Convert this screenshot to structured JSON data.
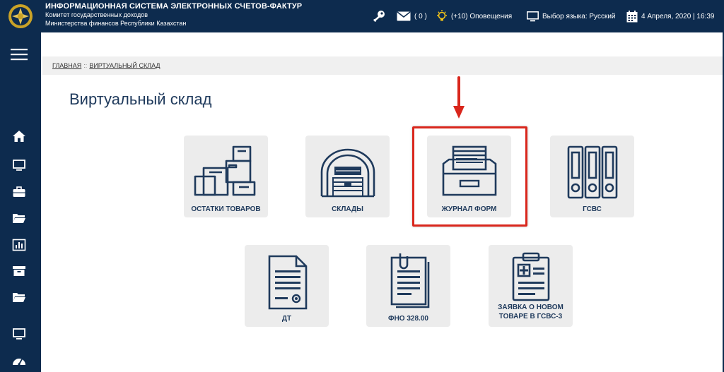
{
  "header": {
    "title_line1": "ИНФОРМАЦИОННАЯ СИСТЕМА ЭЛЕКТРОННЫХ СЧЕТОВ-ФАКТУР",
    "title_line2": "Комитет государственных доходов",
    "title_line3": "Министерства финансов Республики Казахстан",
    "messages_count": "( 0 )",
    "notifications": "(+10) Оповещения",
    "language": "Выбор языка: Русский",
    "datetime": "4 Апреля, 2020 | 16:39"
  },
  "breadcrumb": {
    "home": "ГЛАВНАЯ",
    "separator": "::",
    "current": "ВИРТУАЛЬНЫЙ СКЛАД"
  },
  "page": {
    "title": "Виртуальный склад"
  },
  "tiles": {
    "stock": "ОСТАТКИ ТОВАРОВ",
    "warehouses": "СКЛАДЫ",
    "journal": "ЖУРНАЛ ФОРМ",
    "gsvs": "ГСВС",
    "dt": "ДТ",
    "fno": "ФНО 328.00",
    "request_line1": "ЗАЯВКА О НОВОМ",
    "request_line2": "ТОВАРЕ В ГСВС-3"
  },
  "colors": {
    "navy": "#0d2b4e",
    "icon_blue": "#1f3a5c",
    "highlight_red": "#d9261c",
    "tile_bg": "#ececec"
  },
  "icons": [
    "menu-icon",
    "home-icon",
    "monitor-icon",
    "briefcase-icon",
    "folder-icon",
    "chart-icon",
    "archive-icon",
    "folder-icon",
    "desktop-icon",
    "dashboard-icon",
    "key-icon",
    "mail-icon",
    "bulb-icon",
    "calendar-icon"
  ]
}
